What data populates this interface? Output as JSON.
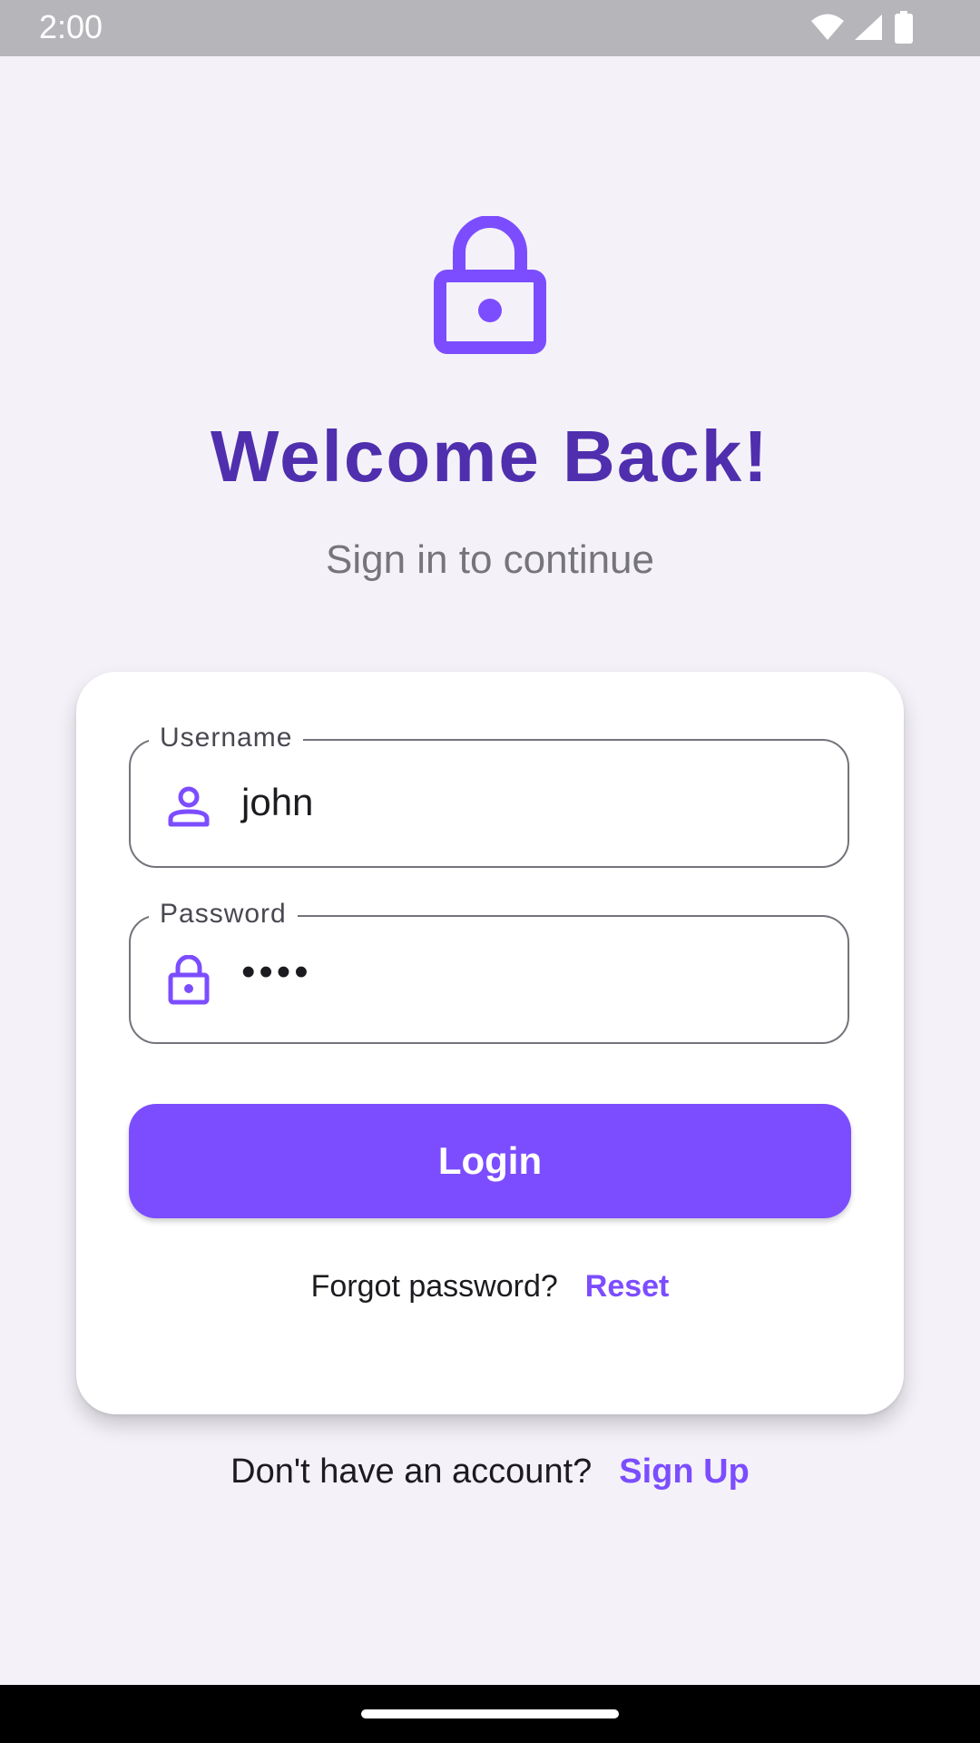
{
  "status_bar": {
    "time": "2:00",
    "icons": [
      "wifi-icon",
      "signal-icon",
      "battery-icon"
    ]
  },
  "header": {
    "icon": "lock-icon",
    "title": "Welcome Back!",
    "subtitle": "Sign in to continue"
  },
  "form": {
    "username": {
      "label": "Username",
      "value": "john",
      "icon": "person-icon"
    },
    "password": {
      "label": "Password",
      "value": "••••",
      "icon": "lock-icon"
    },
    "login_label": "Login",
    "forgot_text": "Forgot password?",
    "reset_label": "Reset"
  },
  "footer": {
    "signup_text": "Don't have an account?",
    "signup_label": "Sign Up"
  },
  "colors": {
    "primary": "#7c4dff",
    "title": "#4f2fae",
    "background": "#f4f2f8",
    "card": "#ffffff"
  }
}
